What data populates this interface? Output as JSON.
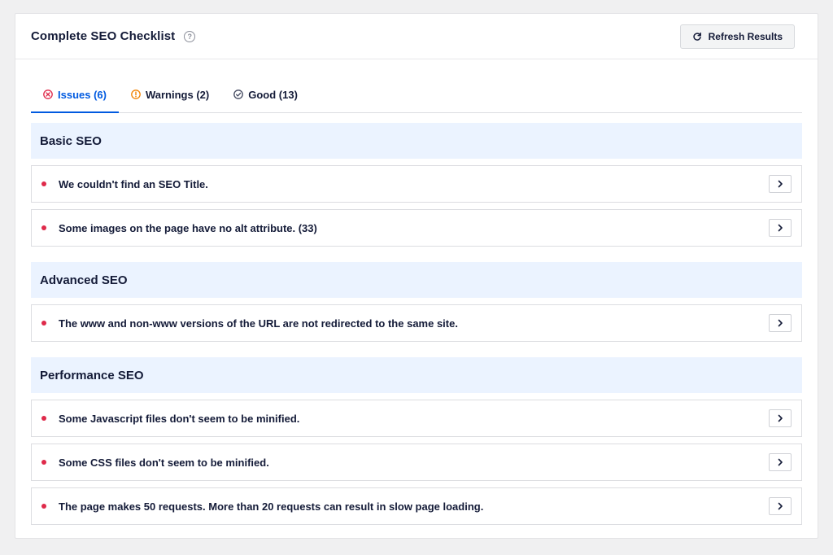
{
  "header": {
    "title": "Complete SEO Checklist",
    "refresh_label": "Refresh Results"
  },
  "tabs": [
    {
      "label": "Issues (6)",
      "icon": "error-circle-icon",
      "color": "#df2a4a",
      "active": true
    },
    {
      "label": "Warnings (2)",
      "icon": "warning-circle-icon",
      "color": "#f18200",
      "active": false
    },
    {
      "label": "Good (13)",
      "icon": "check-circle-icon",
      "color": "#434960",
      "active": false
    }
  ],
  "sections": [
    {
      "title": "Basic SEO",
      "items": [
        "We couldn't find an SEO Title.",
        "Some images on the page have no alt attribute. (33)"
      ]
    },
    {
      "title": "Advanced SEO",
      "items": [
        "The www and non-www versions of the URL are not redirected to the same site."
      ]
    },
    {
      "title": "Performance SEO",
      "items": [
        "Some Javascript files don't seem to be minified.",
        "Some CSS files don't seem to be minified.",
        "The page makes 50 requests. More than 20 requests can result in slow page loading."
      ]
    }
  ],
  "colors": {
    "accent": "#005ae0",
    "issue_dot": "#df2a4a",
    "section_bg": "#ebf3ff"
  }
}
